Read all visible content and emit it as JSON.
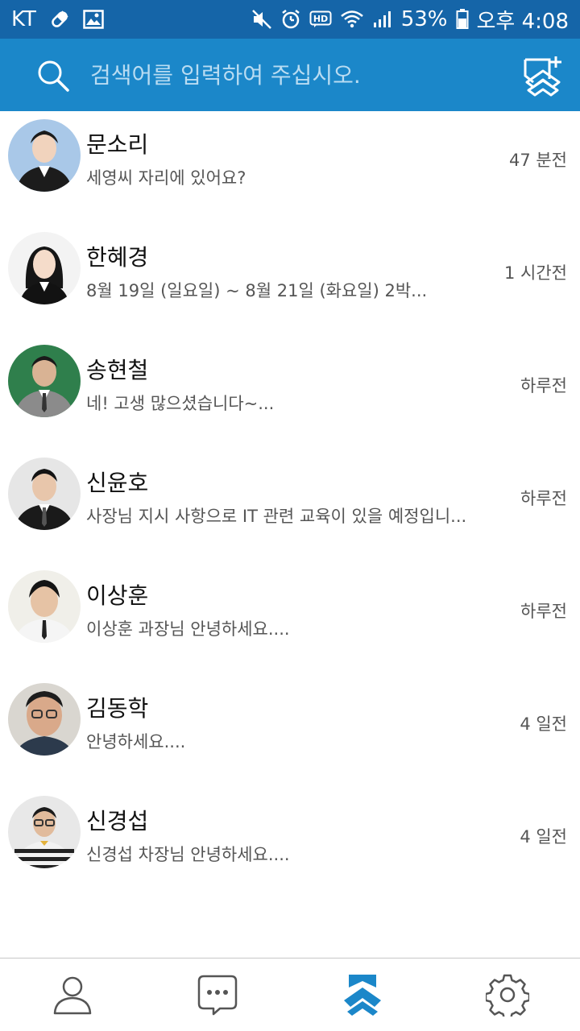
{
  "status_bar": {
    "carrier": "KT",
    "battery": "53%",
    "time": "오후 4:08"
  },
  "search": {
    "placeholder": "검색어를 입력하여 주십시오."
  },
  "chats": [
    {
      "name": "문소리",
      "preview": "세영씨 자리에 있어요?",
      "time": "47 분전"
    },
    {
      "name": "한혜경",
      "preview": "8월 19일 (일요일) ~ 8월 21일 (화요일) 2박...",
      "time": "1 시간전"
    },
    {
      "name": "송현철",
      "preview": "네! 고생 많으셨습니다~...",
      "time": "하루전"
    },
    {
      "name": "신윤호",
      "preview": "사장님 지시 사항으로 IT 관련 교육이 있을 예정입니...",
      "time": "하루전"
    },
    {
      "name": "이상훈",
      "preview": "이상훈 과장님 안녕하세요....",
      "time": "하루전"
    },
    {
      "name": "김동학",
      "preview": "안녕하세요....",
      "time": "4 일전"
    },
    {
      "name": "신경섭",
      "preview": "신경섭 차장님 안녕하세요....",
      "time": "4 일전"
    }
  ],
  "bottom_nav": {
    "items": [
      "person-icon",
      "chat-bubble-icon",
      "app-logo-icon",
      "gear-icon"
    ],
    "active_index": 2
  },
  "colors": {
    "status_bar": "#1565a8",
    "header": "#1b87c9",
    "accent": "#1b87c9",
    "nav_icon": "#555555"
  }
}
